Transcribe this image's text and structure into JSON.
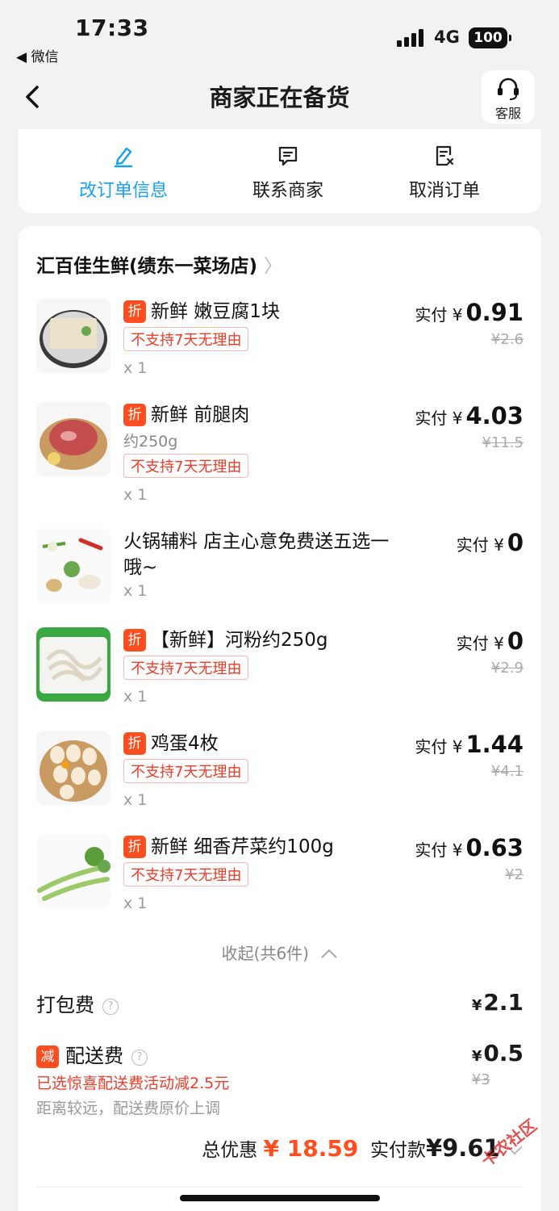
{
  "status": {
    "time": "17:33",
    "back_app": "◀ 微信",
    "network": "4G",
    "battery": "100"
  },
  "nav": {
    "title": "商家正在备货",
    "service_label": "客服"
  },
  "actions": [
    {
      "label": "改订单信息",
      "icon": "edit-icon"
    },
    {
      "label": "联系商家",
      "icon": "chat-icon"
    },
    {
      "label": "取消订单",
      "icon": "cancel-order-icon"
    }
  ],
  "order": {
    "shop_name": "汇百佳生鲜(绩东一菜场店)",
    "items": [
      {
        "name": "新鲜 嫩豆腐1块",
        "discount_badge": "折",
        "tag": "不支持7天无理由",
        "qty": "x 1",
        "paid_label": "实付",
        "currency": "¥",
        "paid": "0.91",
        "original": "¥2.6"
      },
      {
        "name": "新鲜 前腿肉",
        "discount_badge": "折",
        "spec": "约250g",
        "tag": "不支持7天无理由",
        "qty": "x 1",
        "paid_label": "实付",
        "currency": "¥",
        "paid": "4.03",
        "original": "¥11.5"
      },
      {
        "name": "火锅辅料 店主心意免费送五选一哦~",
        "qty": "x 1",
        "paid_label": "实付",
        "currency": "¥",
        "paid": "0"
      },
      {
        "name": "【新鲜】河粉约250g",
        "discount_badge": "折",
        "tag": "不支持7天无理由",
        "qty": "x 1",
        "paid_label": "实付",
        "currency": "¥",
        "paid": "0",
        "original": "¥2.9"
      },
      {
        "name": "鸡蛋4枚",
        "discount_badge": "折",
        "tag": "不支持7天无理由",
        "qty": "x 1",
        "paid_label": "实付",
        "currency": "¥",
        "paid": "1.44",
        "original": "¥4.1"
      },
      {
        "name": "新鲜 细香芹菜约100g",
        "discount_badge": "折",
        "tag": "不支持7天无理由",
        "qty": "x 1",
        "paid_label": "实付",
        "currency": "¥",
        "paid": "0.63",
        "original": "¥2"
      }
    ],
    "collapse_label": "收起(共6件)",
    "packing_fee": {
      "label": "打包费",
      "currency": "¥",
      "amount": "2.1"
    },
    "delivery_fee": {
      "badge": "减",
      "label": "配送费",
      "currency": "¥",
      "amount": "0.5",
      "original": "¥3",
      "promo": "已选惊喜配送费活动减2.5元",
      "note": "距离较远，配送费原价上调"
    },
    "total": {
      "discount_label": "总优惠",
      "discount": "¥ 18.59",
      "paid_label": "实付款",
      "paid": "¥9.61"
    }
  },
  "watermark": "卡农社区",
  "colors": {
    "accent": "#1aa0f0",
    "discount": "#fe4e1f",
    "tag_red": "#ee3b2a"
  }
}
